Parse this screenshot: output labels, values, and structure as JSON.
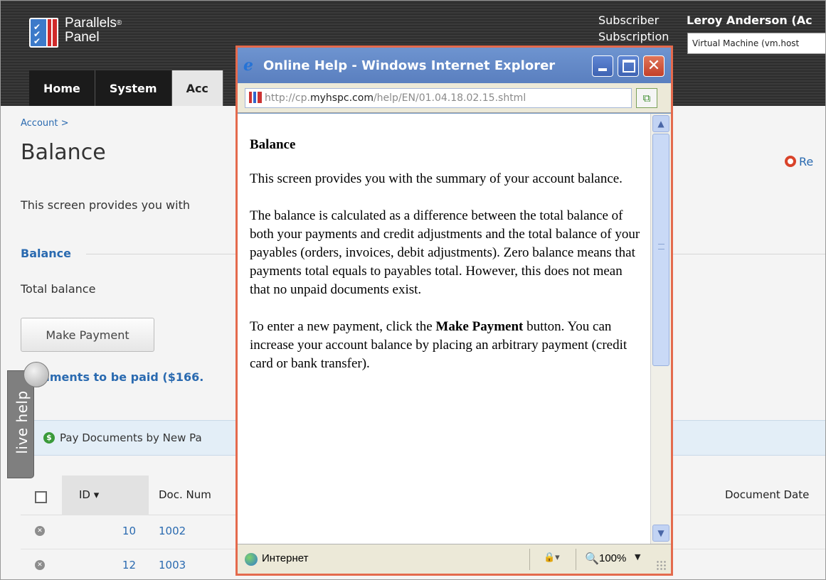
{
  "panel": {
    "logo_line1": "Parallels",
    "logo_sup": "®",
    "logo_line2": "Panel",
    "subscriber_label": "Subscriber",
    "subscription_label": "Subscription",
    "user_name": "Leroy Anderson (Ac",
    "subscription_value": "Virtual Machine (vm.host",
    "nav_tabs": [
      "Home",
      "System",
      "Acc"
    ]
  },
  "page": {
    "breadcrumb": "Account >",
    "title": "Balance",
    "report_link": "Re",
    "intro": "This screen provides you with",
    "balance_heading": "Balance",
    "total_balance_label": "Total balance",
    "make_payment_label": "Make Payment",
    "docs_heading": "cuments to be paid ($166.",
    "pay_link": "Pay Documents by New Pa",
    "table": {
      "columns": {
        "id": "ID",
        "doc_num": "Doc. Num",
        "doc_date": "Document Date"
      },
      "rows": [
        {
          "id": "10",
          "doc_num": "1002"
        },
        {
          "id": "12",
          "doc_num": "1003"
        }
      ]
    },
    "live_help": "live help"
  },
  "help_window": {
    "title": "Online Help - Windows Internet Explorer",
    "url_prefix": "http://cp.",
    "url_host": "myhspc.com",
    "url_path": "/help/EN/01.04.18.02.15.shtml",
    "heading": "Balance",
    "paragraph1": "This screen provides you with the summary of your account balance.",
    "paragraph2": "The balance is calculated as a difference between the total balance of both your payments and credit adjustments and the total balance of your payables (orders, invoices, debit adjustments). Zero balance means that payments total equals to payables total. However, this does not mean that no unpaid documents exist.",
    "paragraph3_start": "To enter a new payment, click the ",
    "paragraph3_bold": "Make Payment",
    "paragraph3_end": " button. You can increase your account balance by placing an arbitrary payment (credit card or bank transfer).",
    "status_zone": "Интернет",
    "zoom": "100%"
  },
  "colors": {
    "panel_header": "#333333",
    "link_blue": "#2a6ab0",
    "popup_border": "#e46a4d",
    "titlebar": "#5a7fbf"
  }
}
